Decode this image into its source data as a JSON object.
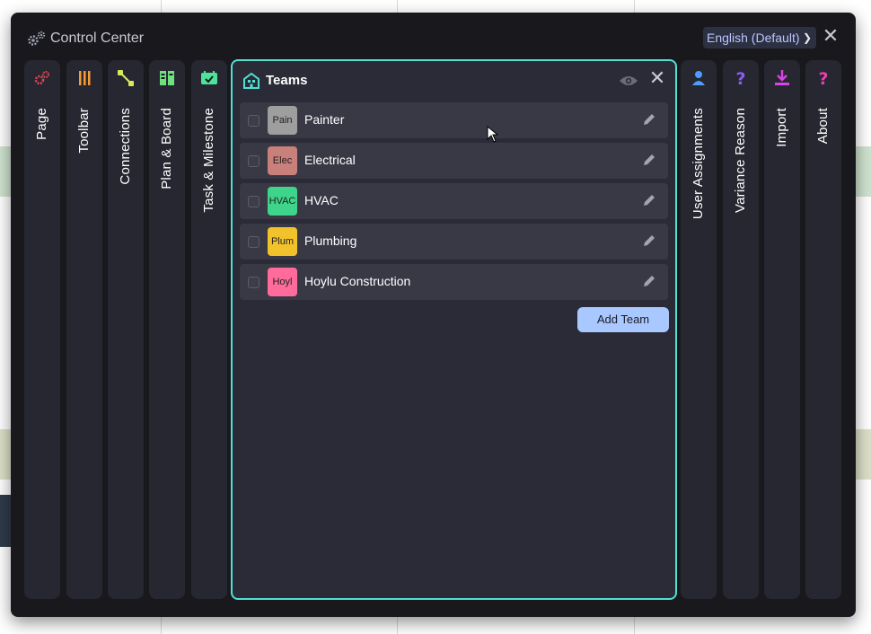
{
  "header": {
    "title": "Control Center",
    "language": "English (Default)"
  },
  "tabs_left": [
    {
      "label": "Page",
      "icon": "gears-icon",
      "color": "#e0464f"
    },
    {
      "label": "Toolbar",
      "icon": "pencils-icon",
      "color": "#f59b3b"
    },
    {
      "label": "Connections",
      "icon": "connections-icon",
      "color": "#d7e85a"
    },
    {
      "label": "Plan & Board",
      "icon": "board-icon",
      "color": "#6ee27c"
    },
    {
      "label": "Task & Milestone",
      "icon": "calendar-check-icon",
      "color": "#4de39a"
    }
  ],
  "tabs_right": [
    {
      "label": "User Assignments",
      "icon": "user-icon",
      "color": "#4f9bff"
    },
    {
      "label": "Variance Reason",
      "icon": "question-icon",
      "color": "#8b5cf6"
    },
    {
      "label": "Import",
      "icon": "download-icon",
      "color": "#d645e6"
    },
    {
      "label": "About",
      "icon": "question-icon",
      "color": "#e93fa8"
    }
  ],
  "teams": {
    "title": "Teams",
    "add_label": "Add Team",
    "rows": [
      {
        "abbr": "Pain",
        "name": "Painter",
        "color": "#9e9e9e"
      },
      {
        "abbr": "Elec",
        "name": "Electrical",
        "color": "#c97f7a"
      },
      {
        "abbr": "HVAC",
        "name": "HVAC",
        "color": "#3ed58a"
      },
      {
        "abbr": "Plum",
        "name": "Plumbing",
        "color": "#f2c22b"
      },
      {
        "abbr": "Hoyl",
        "name": "Hoylu Construction",
        "color": "#ff6b9a"
      }
    ]
  },
  "colors": {
    "accent": "#4fe0d4",
    "panel_bg": "#18181d"
  }
}
